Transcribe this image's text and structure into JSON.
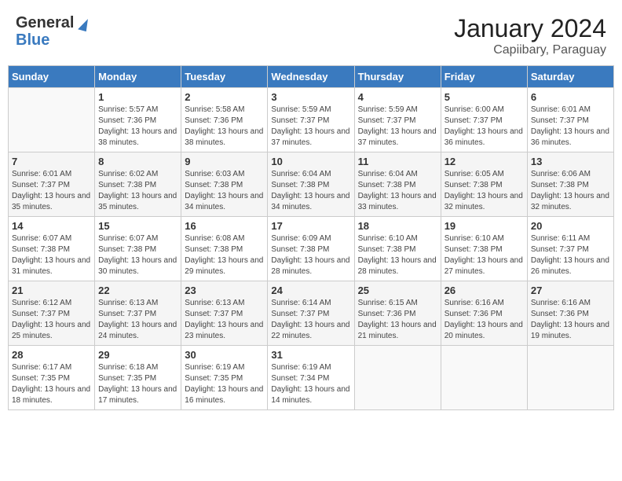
{
  "header": {
    "logo_general": "General",
    "logo_blue": "Blue",
    "month_year": "January 2024",
    "location": "Capiibary, Paraguay"
  },
  "weekdays": [
    "Sunday",
    "Monday",
    "Tuesday",
    "Wednesday",
    "Thursday",
    "Friday",
    "Saturday"
  ],
  "weeks": [
    [
      {
        "day": "",
        "sunrise": "",
        "sunset": "",
        "daylight": ""
      },
      {
        "day": "1",
        "sunrise": "Sunrise: 5:57 AM",
        "sunset": "Sunset: 7:36 PM",
        "daylight": "Daylight: 13 hours and 38 minutes."
      },
      {
        "day": "2",
        "sunrise": "Sunrise: 5:58 AM",
        "sunset": "Sunset: 7:36 PM",
        "daylight": "Daylight: 13 hours and 38 minutes."
      },
      {
        "day": "3",
        "sunrise": "Sunrise: 5:59 AM",
        "sunset": "Sunset: 7:37 PM",
        "daylight": "Daylight: 13 hours and 37 minutes."
      },
      {
        "day": "4",
        "sunrise": "Sunrise: 5:59 AM",
        "sunset": "Sunset: 7:37 PM",
        "daylight": "Daylight: 13 hours and 37 minutes."
      },
      {
        "day": "5",
        "sunrise": "Sunrise: 6:00 AM",
        "sunset": "Sunset: 7:37 PM",
        "daylight": "Daylight: 13 hours and 36 minutes."
      },
      {
        "day": "6",
        "sunrise": "Sunrise: 6:01 AM",
        "sunset": "Sunset: 7:37 PM",
        "daylight": "Daylight: 13 hours and 36 minutes."
      }
    ],
    [
      {
        "day": "7",
        "sunrise": "Sunrise: 6:01 AM",
        "sunset": "Sunset: 7:37 PM",
        "daylight": "Daylight: 13 hours and 35 minutes."
      },
      {
        "day": "8",
        "sunrise": "Sunrise: 6:02 AM",
        "sunset": "Sunset: 7:38 PM",
        "daylight": "Daylight: 13 hours and 35 minutes."
      },
      {
        "day": "9",
        "sunrise": "Sunrise: 6:03 AM",
        "sunset": "Sunset: 7:38 PM",
        "daylight": "Daylight: 13 hours and 34 minutes."
      },
      {
        "day": "10",
        "sunrise": "Sunrise: 6:04 AM",
        "sunset": "Sunset: 7:38 PM",
        "daylight": "Daylight: 13 hours and 34 minutes."
      },
      {
        "day": "11",
        "sunrise": "Sunrise: 6:04 AM",
        "sunset": "Sunset: 7:38 PM",
        "daylight": "Daylight: 13 hours and 33 minutes."
      },
      {
        "day": "12",
        "sunrise": "Sunrise: 6:05 AM",
        "sunset": "Sunset: 7:38 PM",
        "daylight": "Daylight: 13 hours and 32 minutes."
      },
      {
        "day": "13",
        "sunrise": "Sunrise: 6:06 AM",
        "sunset": "Sunset: 7:38 PM",
        "daylight": "Daylight: 13 hours and 32 minutes."
      }
    ],
    [
      {
        "day": "14",
        "sunrise": "Sunrise: 6:07 AM",
        "sunset": "Sunset: 7:38 PM",
        "daylight": "Daylight: 13 hours and 31 minutes."
      },
      {
        "day": "15",
        "sunrise": "Sunrise: 6:07 AM",
        "sunset": "Sunset: 7:38 PM",
        "daylight": "Daylight: 13 hours and 30 minutes."
      },
      {
        "day": "16",
        "sunrise": "Sunrise: 6:08 AM",
        "sunset": "Sunset: 7:38 PM",
        "daylight": "Daylight: 13 hours and 29 minutes."
      },
      {
        "day": "17",
        "sunrise": "Sunrise: 6:09 AM",
        "sunset": "Sunset: 7:38 PM",
        "daylight": "Daylight: 13 hours and 28 minutes."
      },
      {
        "day": "18",
        "sunrise": "Sunrise: 6:10 AM",
        "sunset": "Sunset: 7:38 PM",
        "daylight": "Daylight: 13 hours and 28 minutes."
      },
      {
        "day": "19",
        "sunrise": "Sunrise: 6:10 AM",
        "sunset": "Sunset: 7:38 PM",
        "daylight": "Daylight: 13 hours and 27 minutes."
      },
      {
        "day": "20",
        "sunrise": "Sunrise: 6:11 AM",
        "sunset": "Sunset: 7:37 PM",
        "daylight": "Daylight: 13 hours and 26 minutes."
      }
    ],
    [
      {
        "day": "21",
        "sunrise": "Sunrise: 6:12 AM",
        "sunset": "Sunset: 7:37 PM",
        "daylight": "Daylight: 13 hours and 25 minutes."
      },
      {
        "day": "22",
        "sunrise": "Sunrise: 6:13 AM",
        "sunset": "Sunset: 7:37 PM",
        "daylight": "Daylight: 13 hours and 24 minutes."
      },
      {
        "day": "23",
        "sunrise": "Sunrise: 6:13 AM",
        "sunset": "Sunset: 7:37 PM",
        "daylight": "Daylight: 13 hours and 23 minutes."
      },
      {
        "day": "24",
        "sunrise": "Sunrise: 6:14 AM",
        "sunset": "Sunset: 7:37 PM",
        "daylight": "Daylight: 13 hours and 22 minutes."
      },
      {
        "day": "25",
        "sunrise": "Sunrise: 6:15 AM",
        "sunset": "Sunset: 7:36 PM",
        "daylight": "Daylight: 13 hours and 21 minutes."
      },
      {
        "day": "26",
        "sunrise": "Sunrise: 6:16 AM",
        "sunset": "Sunset: 7:36 PM",
        "daylight": "Daylight: 13 hours and 20 minutes."
      },
      {
        "day": "27",
        "sunrise": "Sunrise: 6:16 AM",
        "sunset": "Sunset: 7:36 PM",
        "daylight": "Daylight: 13 hours and 19 minutes."
      }
    ],
    [
      {
        "day": "28",
        "sunrise": "Sunrise: 6:17 AM",
        "sunset": "Sunset: 7:35 PM",
        "daylight": "Daylight: 13 hours and 18 minutes."
      },
      {
        "day": "29",
        "sunrise": "Sunrise: 6:18 AM",
        "sunset": "Sunset: 7:35 PM",
        "daylight": "Daylight: 13 hours and 17 minutes."
      },
      {
        "day": "30",
        "sunrise": "Sunrise: 6:19 AM",
        "sunset": "Sunset: 7:35 PM",
        "daylight": "Daylight: 13 hours and 16 minutes."
      },
      {
        "day": "31",
        "sunrise": "Sunrise: 6:19 AM",
        "sunset": "Sunset: 7:34 PM",
        "daylight": "Daylight: 13 hours and 14 minutes."
      },
      {
        "day": "",
        "sunrise": "",
        "sunset": "",
        "daylight": ""
      },
      {
        "day": "",
        "sunrise": "",
        "sunset": "",
        "daylight": ""
      },
      {
        "day": "",
        "sunrise": "",
        "sunset": "",
        "daylight": ""
      }
    ]
  ]
}
